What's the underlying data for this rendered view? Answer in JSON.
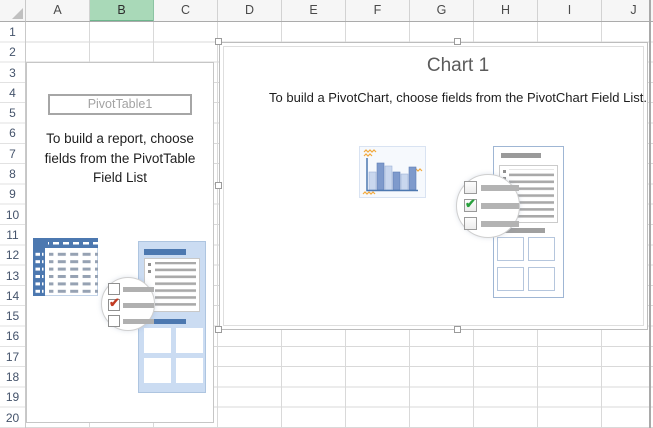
{
  "columns": {
    "headers": [
      "A",
      "B",
      "C",
      "D",
      "E",
      "F",
      "G",
      "H",
      "I",
      "J"
    ],
    "selected_header": "B"
  },
  "rows": {
    "headers": [
      "1",
      "2",
      "3",
      "4",
      "5",
      "6",
      "7",
      "8",
      "9",
      "10",
      "11",
      "12",
      "13",
      "14",
      "15",
      "16",
      "17",
      "18",
      "19",
      "20"
    ]
  },
  "pivot_panel": {
    "table_name": "PivotTable1",
    "instruction": "To build a report, choose fields from the PivotTable Field List"
  },
  "chart_panel": {
    "title": "Chart 1",
    "instruction": "To build a PivotChart, choose fields from the PivotChart Field List."
  },
  "icons": {
    "checkmark": "✔",
    "pivot_table_icon": "pivot-table-grid",
    "pivot_field_list_icon": "field-list-panel-with-checkboxes",
    "chart_bars_icon": "bar-chart-thumbnail",
    "chart_field_list_icon": "field-list-panel-with-checkboxes"
  },
  "colors": {
    "selected_header_bg": "#a9d9b8",
    "accent_blue": "#4c78b0",
    "panel_blue": "#cbdcf2",
    "bar_light": "#c9d7ee",
    "bar_dark": "#7e9acc",
    "check_red": "#c23b22",
    "check_green": "#28a03c",
    "squiggle_orange": "#f2a93e",
    "gridline": "#d9d9d9"
  }
}
